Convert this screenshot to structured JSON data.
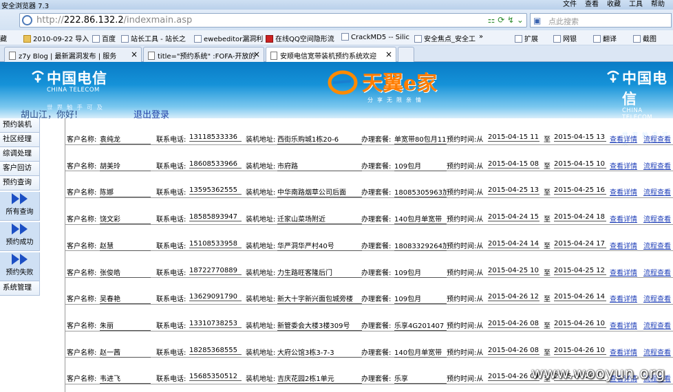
{
  "browser": {
    "window_title": "安全浏览器 7.3",
    "menu": [
      "文件",
      "查看",
      "收藏",
      "工具",
      "帮助"
    ],
    "url_gray": "http://",
    "url_host": "222.86.132.2",
    "url_path": "/indexmain.asp",
    "search_placeholder": "点此搜索",
    "favorites": [
      {
        "label": "藏",
        "icon": "star-icon"
      },
      {
        "label": "2010-09-22 导入",
        "icon": "folder-icon"
      },
      {
        "label": "百度",
        "icon": "page-icon"
      },
      {
        "label": "站长工具 - 站长之",
        "icon": "page-icon"
      },
      {
        "label": "ewebeditor漏洞利",
        "icon": "page-icon"
      },
      {
        "label": "在线QQ空间隐形流",
        "icon": "qq-icon"
      },
      {
        "label": "CrackMD5 -- Silic",
        "icon": "page-icon"
      },
      {
        "label": "安全焦点_安全工",
        "icon": "page-icon"
      },
      {
        "label": "»",
        "icon": ""
      },
      {
        "label": "扩展",
        "icon": "extension-icon"
      },
      {
        "label": "网银",
        "icon": "bank-icon"
      },
      {
        "label": "翻译",
        "icon": "translate-icon"
      },
      {
        "label": "截图",
        "icon": "screenshot-icon"
      }
    ],
    "tabs": [
      {
        "label": "z7y Blog | 最新漏洞发布 | 服务"
      },
      {
        "label": "title=\"预约系统\" :FOFA-开放的"
      },
      {
        "label": "安顺电信宽带装机预约系统欢迎"
      }
    ]
  },
  "header": {
    "brand_cn": "中国电信",
    "brand_en": "CHINA TELECOM",
    "slogan": "世界触手可及",
    "tianyi": "天翼e家",
    "tianyi_sub": "分享无限亲情",
    "user_greeting": "胡山江，你好!",
    "logout": "退出登录"
  },
  "nav": {
    "items_top": [
      "预约装机",
      "社区经理",
      "综调处理",
      "客户回访",
      "预约查询"
    ],
    "sub_items": [
      "所有查询",
      "预约成功",
      "预约失败"
    ],
    "items_bottom": [
      "系统管理"
    ]
  },
  "labels": {
    "name": "客户名称:",
    "phone": "联系电话:",
    "address": "装机地址:",
    "package": "办理套餐:",
    "time": "预约时间:从",
    "to": "至",
    "detail": "查看详情",
    "flow": "流程查看"
  },
  "records": [
    {
      "name": "袁纯龙",
      "phone": "13118533336",
      "address": "西街乐购城1栋20-6",
      "package": "单宽带80包月11",
      "start": "2015-04-15 11",
      "end": "2015-04-15 13"
    },
    {
      "name": "胡美玲",
      "phone": "18608533966",
      "address": "市府路",
      "package": "109包月",
      "start": "2015-04-15 08",
      "end": "2015-04-15 10"
    },
    {
      "name": "陈娜",
      "phone": "13595362555",
      "address": "中华南路烟草公司后面",
      "package": "18085305963加",
      "start": "2015-04-25 13",
      "end": "2015-04-25 16"
    },
    {
      "name": "饶文彩",
      "phone": "18585893947",
      "address": "迁家山菜场附近",
      "package": "140包月单宽带",
      "start": "2015-04-24 15",
      "end": "2015-04-24 18"
    },
    {
      "name": "赵慧",
      "phone": "15108533958",
      "address": "华严洞华严村40号",
      "package": "18083329264加",
      "start": "2015-04-24 14",
      "end": "2015-04-24 17"
    },
    {
      "name": "张俊皓",
      "phone": "18722770889",
      "address": "力生路旺客隆后门",
      "package": "109包月",
      "start": "2015-04-25 10",
      "end": "2015-04-25 12"
    },
    {
      "name": "吴春艳",
      "phone": "13629091790",
      "address": "新大十字新兴面包城旁楼",
      "package": "109包月",
      "start": "2015-04-26 12",
      "end": "2015-04-26 14"
    },
    {
      "name": "朱丽",
      "phone": "13310738253",
      "address": "新管委会大楼3楼309号",
      "package": "乐享4G201407",
      "start": "2015-04-26 08",
      "end": "2015-04-26 10"
    },
    {
      "name": "赵一茜",
      "phone": "18285368555",
      "address": "大府公馆3栋3-7-3",
      "package": "140包月单宽带",
      "start": "2015-04-26 08",
      "end": "2015-04-26 10"
    },
    {
      "name": "韦进飞",
      "phone": "15685350512",
      "address": "吉庆花园2栋1单元",
      "package": "乐享",
      "start": "2015-04-26 09",
      "end": "2015-04-26 11"
    }
  ],
  "watermark": "www.wooyun.org"
}
